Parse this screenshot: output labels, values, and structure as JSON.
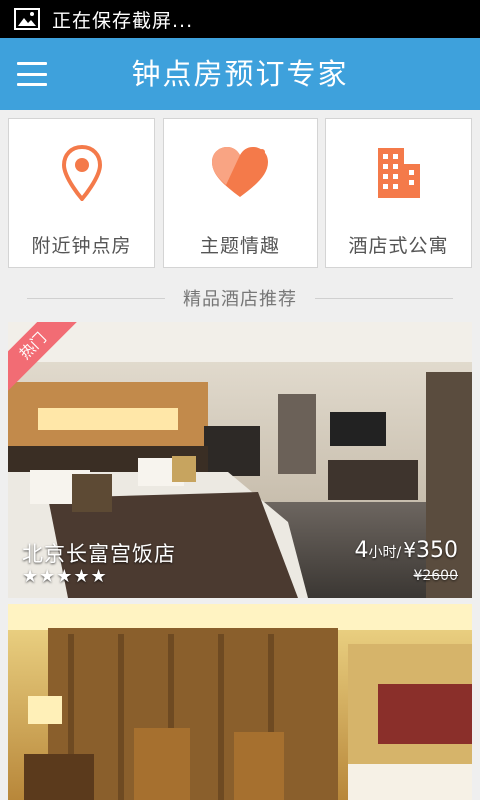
{
  "status_bar": {
    "notification": "正在保存截屏..."
  },
  "header": {
    "title": "钟点房预订专家"
  },
  "categories": [
    {
      "label": "附近钟点房",
      "icon": "location-pin-icon"
    },
    {
      "label": "主题情趣",
      "icon": "heart-icon"
    },
    {
      "label": "酒店式公寓",
      "icon": "building-icon"
    }
  ],
  "section": {
    "title": "精品酒店推荐"
  },
  "hotels": [
    {
      "tag": "热门",
      "name": "北京长富宫饭店",
      "stars": "★★★★★",
      "hours": "4",
      "hours_unit": "小时/",
      "currency": "¥",
      "price": "350",
      "original_price": "¥2600"
    },
    {
      "name": ""
    }
  ],
  "colors": {
    "accent": "#3ea1dc",
    "icon_orange": "#f47a4a",
    "hot_tag": "#f26c74"
  }
}
